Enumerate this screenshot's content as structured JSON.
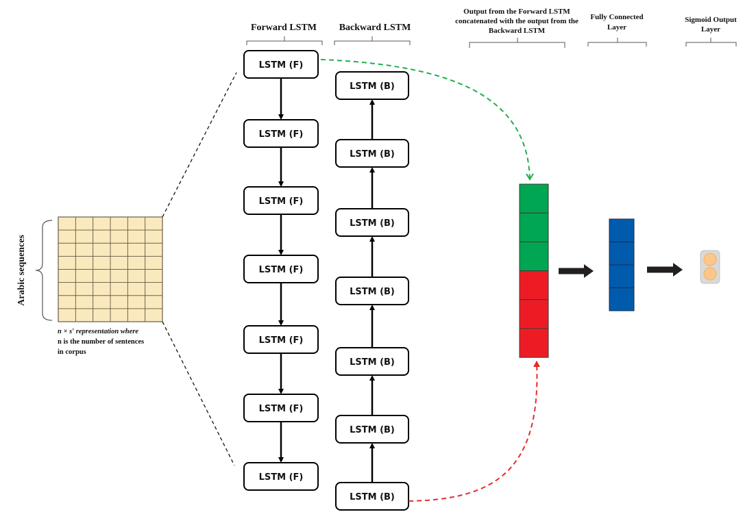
{
  "headers": {
    "forward": "Forward LSTM",
    "backward": "Backward LSTM",
    "concat": [
      "Output from the Forward LSTM",
      "concatenated with the output from the",
      "Backward LSTM"
    ],
    "fully_connected": [
      "Fully Connected",
      "Layer"
    ],
    "sigmoid": [
      "Sigmoid Output",
      "Layer"
    ]
  },
  "input": {
    "side_label": "Arabic sequences",
    "caption": [
      "n × s′ representation where",
      "n is the number of sentences",
      "in corpus"
    ],
    "grid_rows": 8,
    "grid_cols": 6,
    "fill_color": "#fbe9be"
  },
  "forward_cells": [
    "LSTM (F)",
    "LSTM (F)",
    "LSTM (F)",
    "LSTM (F)",
    "LSTM (F)",
    "LSTM (F)",
    "LSTM (F)"
  ],
  "backward_cells": [
    "LSTM (B)",
    "LSTM (B)",
    "LSTM (B)",
    "LSTM (B)",
    "LSTM (B)",
    "LSTM (B)",
    "LSTM (B)"
  ],
  "concat_vector": {
    "forward_units": 3,
    "backward_units": 3,
    "forward_color": "#00a651",
    "backward_color": "#ed1c24"
  },
  "dense_vector": {
    "units": 4,
    "color": "#005bac"
  },
  "sigmoid": {
    "units": 2,
    "fill": "#fdc68a",
    "frame": "#d9d9d9"
  },
  "connectors": {
    "forward_color": "#1fad4a",
    "backward_color": "#e62a2a"
  }
}
